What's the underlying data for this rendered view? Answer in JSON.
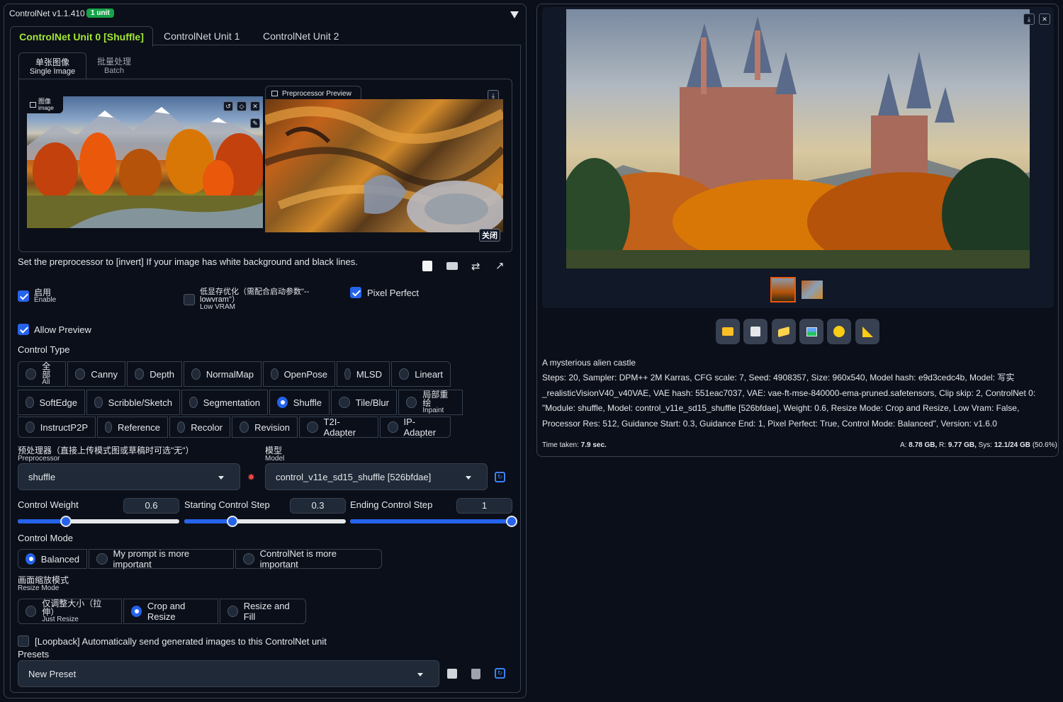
{
  "header": {
    "title": "ControlNet v1.1.410",
    "badge": "1 unit",
    "collapse_icon": "triangle-down-icon"
  },
  "unit_tabs": [
    "ControlNet Unit 0 [Shuffle]",
    "ControlNet Unit 1",
    "ControlNet Unit 2"
  ],
  "mode_tabs": [
    {
      "zh": "单张图像",
      "en": "Single Image"
    },
    {
      "zh": "批量处理",
      "en": "Batch"
    }
  ],
  "image_box": {
    "label_zh": "图像",
    "label_en": "image"
  },
  "preview": {
    "label": "Preprocessor Preview",
    "close_label": "关闭"
  },
  "hint": "Set the preprocessor to [invert] If your image has white background and black lines.",
  "enable": {
    "zh": "启用",
    "en": "Enable",
    "checked": true
  },
  "lowvram": {
    "zh": "低显存优化（需配合启动参数\"--",
    "zh2": "lowvram\"）",
    "en": "Low VRAM",
    "checked": false
  },
  "pixel_perfect": {
    "label": "Pixel Perfect",
    "checked": true
  },
  "allow_preview": {
    "label": "Allow Preview",
    "checked": true
  },
  "control_type": {
    "label": "Control Type",
    "selected": "Shuffle",
    "row1": [
      {
        "zh": "全部",
        "en": "All"
      },
      {
        "label": "Canny"
      },
      {
        "label": "Depth"
      },
      {
        "label": "NormalMap"
      },
      {
        "label": "OpenPose"
      },
      {
        "label": "MLSD"
      },
      {
        "label": "Lineart"
      }
    ],
    "row2": [
      {
        "label": "SoftEdge"
      },
      {
        "label": "Scribble/Sketch"
      },
      {
        "label": "Segmentation"
      },
      {
        "label": "Shuffle"
      },
      {
        "label": "Tile/Blur"
      },
      {
        "zh": "局部重绘",
        "en": "Inpaint"
      }
    ],
    "row3": [
      {
        "label": "InstructP2P"
      },
      {
        "label": "Reference"
      },
      {
        "label": "Recolor"
      },
      {
        "label": "Revision"
      },
      {
        "label": "T2I-Adapter"
      },
      {
        "label": "IP-Adapter"
      }
    ]
  },
  "preprocessor": {
    "zh": "预处理器（直接上传模式图或草稿时可选\"无\"）",
    "en": "Preprocessor",
    "value": "shuffle"
  },
  "model": {
    "zh": "模型",
    "en": "Model",
    "value": "control_v11e_sd15_shuffle [526bfdae]"
  },
  "control_weight": {
    "label": "Control Weight",
    "value": "0.6",
    "fraction": 0.3
  },
  "starting_step": {
    "label": "Starting Control Step",
    "value": "0.3",
    "fraction": 0.3
  },
  "ending_step": {
    "label": "Ending Control Step",
    "value": "1",
    "fraction": 1.0
  },
  "control_mode": {
    "label": "Control Mode",
    "options": [
      "Balanced",
      "My prompt is more important",
      "ControlNet is more important"
    ],
    "selected": "Balanced"
  },
  "resize_mode": {
    "zh": "画面缩放模式",
    "en": "Resize Mode",
    "options": [
      {
        "zh": "仅调整大小（拉伸）",
        "en": "Just Resize"
      },
      {
        "label": "Crop and Resize"
      },
      {
        "label": "Resize and Fill"
      }
    ],
    "selected": "Crop and Resize"
  },
  "loopback": {
    "label": "[Loopback] Automatically send generated images to this ControlNet unit",
    "checked": false
  },
  "presets": {
    "label": "Presets",
    "value": "New Preset"
  },
  "output": {
    "prompt": "A mysterious alien castle",
    "params": "Steps: 20, Sampler: DPM++ 2M Karras, CFG scale: 7, Seed: 4908357, Size: 960x540, Model hash: e9d3cedc4b, Model: 写实_realisticVisionV40_v40VAE, VAE hash: 551eac7037, VAE: vae-ft-mse-840000-ema-pruned.safetensors, Clip skip: 2, ControlNet 0: \"Module: shuffle, Model: control_v11e_sd15_shuffle [526bfdae], Weight: 0.6, Resize Mode: Crop and Resize, Low Vram: False, Processor Res: 512, Guidance Start: 0.3, Guidance End: 1, Pixel Perfect: True, Control Mode: Balanced\", Version: v1.6.0",
    "time_label": "Time taken:",
    "time_value": "7.9 sec.",
    "mem_a_label": "A:",
    "mem_a": "8.78 GB,",
    "mem_r_label": "R:",
    "mem_r": "9.77 GB,",
    "mem_sys_label": "Sys:",
    "mem_sys": "12.1/24 GB",
    "mem_pct": "(50.6%)"
  },
  "toolbar_icons": [
    "folder-icon",
    "save-icon",
    "zip-icon",
    "image-icon",
    "palette-icon",
    "ruler-icon"
  ],
  "colors": {
    "accent": "#2563eb",
    "tab_active": "#a3e635",
    "badge": "#16a34a",
    "bg": "#0b0f19"
  }
}
